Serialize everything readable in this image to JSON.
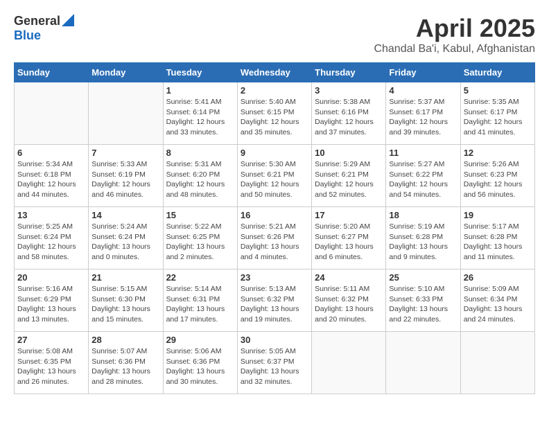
{
  "header": {
    "logo_general": "General",
    "logo_blue": "Blue",
    "month_title": "April 2025",
    "location": "Chandal Ba'i, Kabul, Afghanistan"
  },
  "days_of_week": [
    "Sunday",
    "Monday",
    "Tuesday",
    "Wednesday",
    "Thursday",
    "Friday",
    "Saturday"
  ],
  "weeks": [
    [
      {
        "day": "",
        "info": ""
      },
      {
        "day": "",
        "info": ""
      },
      {
        "day": "1",
        "info": "Sunrise: 5:41 AM\nSunset: 6:14 PM\nDaylight: 12 hours and 33 minutes."
      },
      {
        "day": "2",
        "info": "Sunrise: 5:40 AM\nSunset: 6:15 PM\nDaylight: 12 hours and 35 minutes."
      },
      {
        "day": "3",
        "info": "Sunrise: 5:38 AM\nSunset: 6:16 PM\nDaylight: 12 hours and 37 minutes."
      },
      {
        "day": "4",
        "info": "Sunrise: 5:37 AM\nSunset: 6:17 PM\nDaylight: 12 hours and 39 minutes."
      },
      {
        "day": "5",
        "info": "Sunrise: 5:35 AM\nSunset: 6:17 PM\nDaylight: 12 hours and 41 minutes."
      }
    ],
    [
      {
        "day": "6",
        "info": "Sunrise: 5:34 AM\nSunset: 6:18 PM\nDaylight: 12 hours and 44 minutes."
      },
      {
        "day": "7",
        "info": "Sunrise: 5:33 AM\nSunset: 6:19 PM\nDaylight: 12 hours and 46 minutes."
      },
      {
        "day": "8",
        "info": "Sunrise: 5:31 AM\nSunset: 6:20 PM\nDaylight: 12 hours and 48 minutes."
      },
      {
        "day": "9",
        "info": "Sunrise: 5:30 AM\nSunset: 6:21 PM\nDaylight: 12 hours and 50 minutes."
      },
      {
        "day": "10",
        "info": "Sunrise: 5:29 AM\nSunset: 6:21 PM\nDaylight: 12 hours and 52 minutes."
      },
      {
        "day": "11",
        "info": "Sunrise: 5:27 AM\nSunset: 6:22 PM\nDaylight: 12 hours and 54 minutes."
      },
      {
        "day": "12",
        "info": "Sunrise: 5:26 AM\nSunset: 6:23 PM\nDaylight: 12 hours and 56 minutes."
      }
    ],
    [
      {
        "day": "13",
        "info": "Sunrise: 5:25 AM\nSunset: 6:24 PM\nDaylight: 12 hours and 58 minutes."
      },
      {
        "day": "14",
        "info": "Sunrise: 5:24 AM\nSunset: 6:24 PM\nDaylight: 13 hours and 0 minutes."
      },
      {
        "day": "15",
        "info": "Sunrise: 5:22 AM\nSunset: 6:25 PM\nDaylight: 13 hours and 2 minutes."
      },
      {
        "day": "16",
        "info": "Sunrise: 5:21 AM\nSunset: 6:26 PM\nDaylight: 13 hours and 4 minutes."
      },
      {
        "day": "17",
        "info": "Sunrise: 5:20 AM\nSunset: 6:27 PM\nDaylight: 13 hours and 6 minutes."
      },
      {
        "day": "18",
        "info": "Sunrise: 5:19 AM\nSunset: 6:28 PM\nDaylight: 13 hours and 9 minutes."
      },
      {
        "day": "19",
        "info": "Sunrise: 5:17 AM\nSunset: 6:28 PM\nDaylight: 13 hours and 11 minutes."
      }
    ],
    [
      {
        "day": "20",
        "info": "Sunrise: 5:16 AM\nSunset: 6:29 PM\nDaylight: 13 hours and 13 minutes."
      },
      {
        "day": "21",
        "info": "Sunrise: 5:15 AM\nSunset: 6:30 PM\nDaylight: 13 hours and 15 minutes."
      },
      {
        "day": "22",
        "info": "Sunrise: 5:14 AM\nSunset: 6:31 PM\nDaylight: 13 hours and 17 minutes."
      },
      {
        "day": "23",
        "info": "Sunrise: 5:13 AM\nSunset: 6:32 PM\nDaylight: 13 hours and 19 minutes."
      },
      {
        "day": "24",
        "info": "Sunrise: 5:11 AM\nSunset: 6:32 PM\nDaylight: 13 hours and 20 minutes."
      },
      {
        "day": "25",
        "info": "Sunrise: 5:10 AM\nSunset: 6:33 PM\nDaylight: 13 hours and 22 minutes."
      },
      {
        "day": "26",
        "info": "Sunrise: 5:09 AM\nSunset: 6:34 PM\nDaylight: 13 hours and 24 minutes."
      }
    ],
    [
      {
        "day": "27",
        "info": "Sunrise: 5:08 AM\nSunset: 6:35 PM\nDaylight: 13 hours and 26 minutes."
      },
      {
        "day": "28",
        "info": "Sunrise: 5:07 AM\nSunset: 6:36 PM\nDaylight: 13 hours and 28 minutes."
      },
      {
        "day": "29",
        "info": "Sunrise: 5:06 AM\nSunset: 6:36 PM\nDaylight: 13 hours and 30 minutes."
      },
      {
        "day": "30",
        "info": "Sunrise: 5:05 AM\nSunset: 6:37 PM\nDaylight: 13 hours and 32 minutes."
      },
      {
        "day": "",
        "info": ""
      },
      {
        "day": "",
        "info": ""
      },
      {
        "day": "",
        "info": ""
      }
    ]
  ]
}
